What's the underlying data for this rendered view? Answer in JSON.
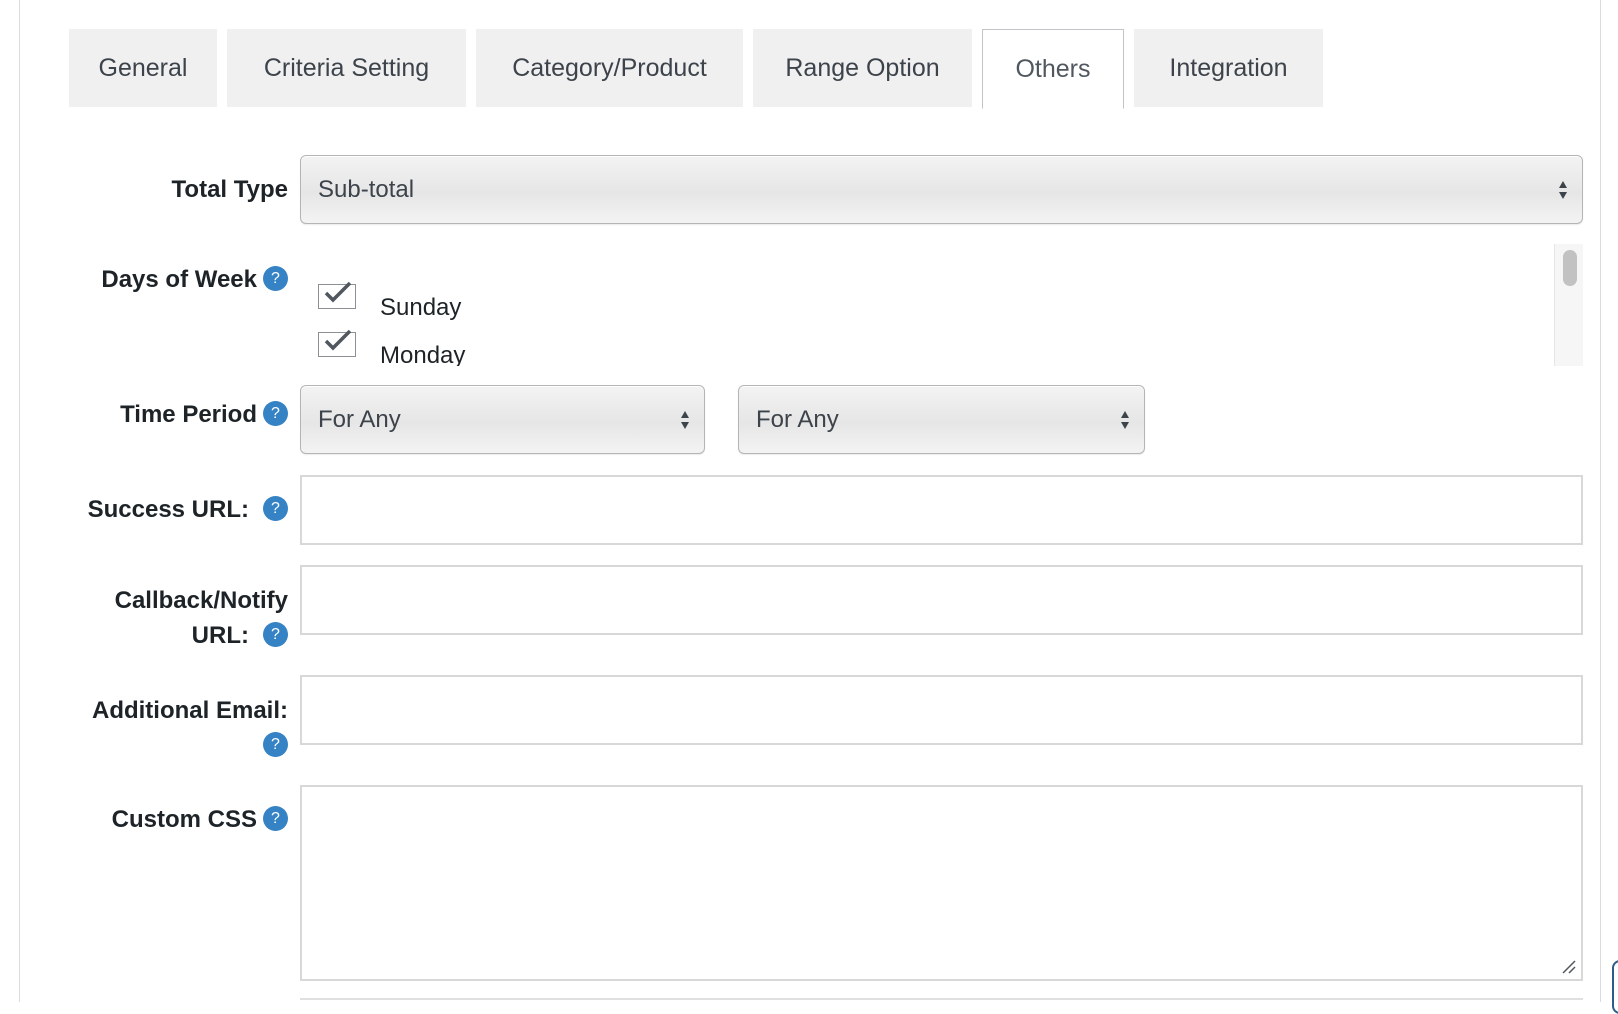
{
  "tabs": {
    "items": [
      {
        "label": "General",
        "active": false
      },
      {
        "label": "Criteria Setting",
        "active": false
      },
      {
        "label": "Category/Product",
        "active": false
      },
      {
        "label": "Range Option",
        "active": false
      },
      {
        "label": "Others",
        "active": true
      },
      {
        "label": "Integration",
        "active": false
      }
    ]
  },
  "form": {
    "help_glyph": "?",
    "total_type": {
      "label": "Total Type",
      "value": "Sub-total"
    },
    "days_of_week": {
      "label": "Days of Week",
      "options": [
        {
          "label": "Sunday",
          "checked": true
        },
        {
          "label": "Monday",
          "checked": true
        }
      ]
    },
    "time_period": {
      "label": "Time Period",
      "from_value": "For Any",
      "to_value": "For Any"
    },
    "success_url": {
      "label": "Success URL:",
      "value": ""
    },
    "callback_url": {
      "label_line1": "Callback/Notify",
      "label_line2": "URL:",
      "value": ""
    },
    "additional_email": {
      "label": "Additional Email:",
      "value": ""
    },
    "custom_css": {
      "label": "Custom CSS",
      "value": ""
    }
  },
  "colors": {
    "help_icon": "#3582c4",
    "tab_inactive_bg": "#f0f0f1",
    "tab_active_bg": "#ffffff"
  }
}
